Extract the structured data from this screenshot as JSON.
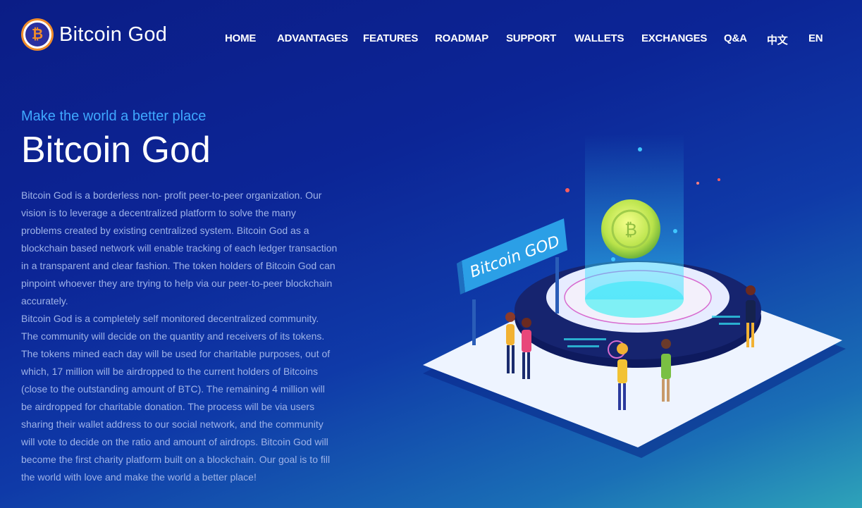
{
  "brand": {
    "name": "Bitcoin God",
    "logo_icon": "bitcoin-icon",
    "accent": "#f08c2b"
  },
  "nav": {
    "items": [
      "HOME",
      "ADVANTAGES",
      "FEATURES",
      "ROADMAP",
      "SUPPORT",
      "WALLETS",
      "EXCHANGES",
      "Q&A",
      "中文",
      "EN"
    ]
  },
  "hero": {
    "tagline": "Make the world a better place",
    "title": "Bitcoin God",
    "paragraph1": "Bitcoin God is a borderless non- profit peer-to-peer organization. Our vision is to leverage a decentralized platform to solve the many problems created by existing centralized system. Bitcoin God as a blockchain based network will enable tracking of each ledger transaction in a transparent and clear fashion. The token holders of Bitcoin God can pinpoint whoever they are trying to help via our peer-to-peer blockchain accurately.",
    "paragraph2": "Bitcoin God is a completely self monitored decentralized community. The community will decide on the quantity and receivers of its tokens. The tokens mined each day will be used for charitable purposes, out of which, 17 million will be airdropped to the current holders of Bitcoins (close to the outstanding amount of BTC). The remaining 4 million will be airdropped for charitable donation. The process will be via users sharing their wallet address to our social network, and the community will vote to decide on the ratio and amount of airdrops. Bitcoin God will become the first charity platform built on a blockchain. Our goal is to fill the world with love and make the world a better place!"
  },
  "illustration": {
    "sign_text": "Bitcoin GOD",
    "coin_icon": "bitcoin-coin-icon"
  },
  "colors": {
    "tagline": "#3fa8ff",
    "body_text": "#9fb3e8",
    "background_top": "#0b1d86",
    "background_bottom": "#2ea3b9"
  }
}
